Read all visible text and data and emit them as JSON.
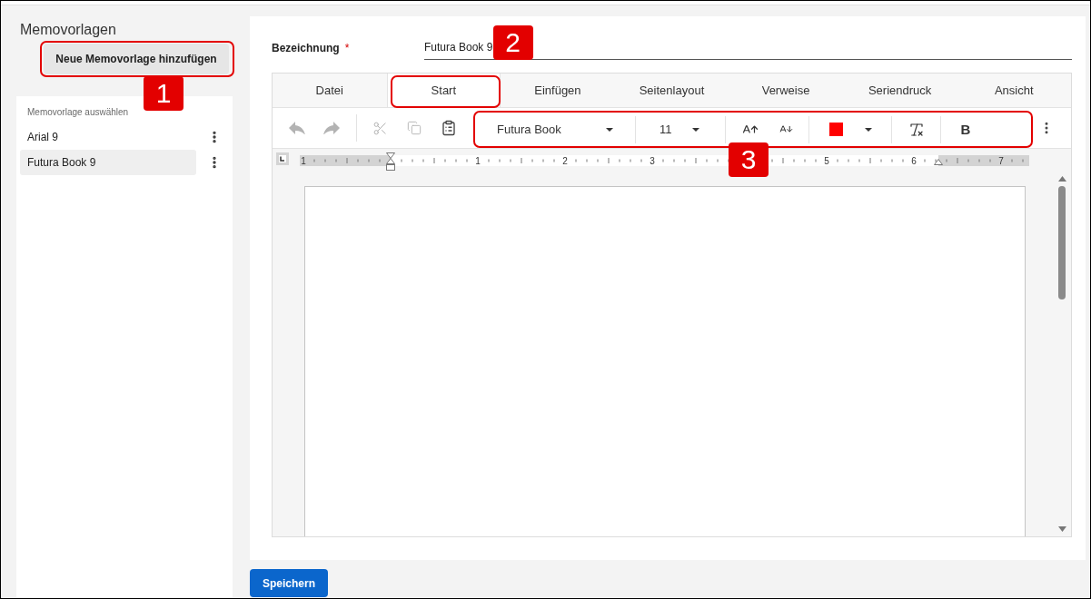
{
  "sidebar": {
    "title": "Memovorlagen",
    "add_button": {
      "label": "Neue Memovorlage hinzufügen",
      "callout": "1"
    },
    "templates": {
      "heading": "Memovorlage auswählen",
      "items": [
        {
          "label": "Arial 9",
          "selected": false
        },
        {
          "label": "Futura Book 9",
          "selected": true
        }
      ]
    }
  },
  "form": {
    "name_field": {
      "label": "Bezeichnung",
      "required_mark": "*",
      "value": "Futura Book 9"
    }
  },
  "editor": {
    "tabs": [
      {
        "label": "Datei",
        "selected": false
      },
      {
        "label": "Start",
        "selected": true,
        "callout": "2"
      },
      {
        "label": "Einfügen",
        "selected": false
      },
      {
        "label": "Seitenlayout",
        "selected": false
      },
      {
        "label": "Verweise",
        "selected": false
      },
      {
        "label": "Seriendruck",
        "selected": false
      },
      {
        "label": "Ansicht",
        "selected": false
      }
    ],
    "toolbar": {
      "history": [
        {
          "kind": "undo",
          "disabled": true
        },
        {
          "kind": "redo",
          "disabled": true
        }
      ],
      "clipboard": [
        {
          "kind": "cut",
          "disabled": true
        },
        {
          "kind": "copy",
          "disabled": true
        },
        {
          "kind": "paste",
          "disabled": false
        }
      ],
      "format": {
        "callout": "3",
        "font": "Futura Book",
        "size": "11",
        "color": "#ff0000",
        "bold": "B"
      }
    },
    "ruler": {
      "numbers": [
        "1",
        "1",
        "2",
        "3",
        "5",
        "6",
        "7"
      ]
    }
  },
  "save_button": {
    "label": "Speichern"
  }
}
